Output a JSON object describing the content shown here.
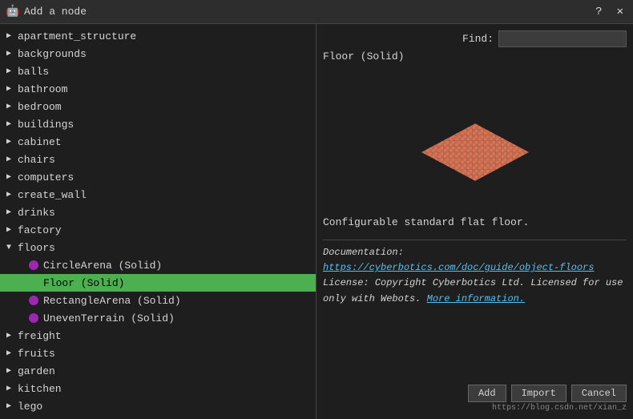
{
  "titleBar": {
    "icon": "🤖",
    "title": "Add a node",
    "helpBtn": "?",
    "closeBtn": "✕"
  },
  "findBar": {
    "label": "Find:",
    "placeholder": ""
  },
  "previewTitle": "Floor (Solid)",
  "previewDescription": "Configurable standard flat floor.",
  "documentation": {
    "label": "Documentation:",
    "linkText": "https://cyberbotics.com/doc/guide/object-floors",
    "licenseLabel": "License:",
    "licenseText": "Copyright Cyberbotics Ltd. Licensed for use only with Webots.",
    "moreInfoText": "More information."
  },
  "treeItems": [
    {
      "id": "apartment_structure",
      "label": "apartment_structure",
      "type": "parent",
      "expanded": false
    },
    {
      "id": "backgrounds",
      "label": "backgrounds",
      "type": "parent",
      "expanded": false
    },
    {
      "id": "balls",
      "label": "balls",
      "type": "parent",
      "expanded": false
    },
    {
      "id": "bathroom",
      "label": "bathroom",
      "type": "parent",
      "expanded": false
    },
    {
      "id": "bedroom",
      "label": "bedroom",
      "type": "parent",
      "expanded": false
    },
    {
      "id": "buildings",
      "label": "buildings",
      "type": "parent",
      "expanded": false
    },
    {
      "id": "cabinet",
      "label": "cabinet",
      "type": "parent",
      "expanded": false
    },
    {
      "id": "chairs",
      "label": "chairs",
      "type": "parent",
      "expanded": false
    },
    {
      "id": "computers",
      "label": "computers",
      "type": "parent",
      "expanded": false
    },
    {
      "id": "create_wall",
      "label": "create_wall",
      "type": "parent",
      "expanded": false
    },
    {
      "id": "drinks",
      "label": "drinks",
      "type": "parent",
      "expanded": false
    },
    {
      "id": "factory",
      "label": "factory",
      "type": "parent",
      "expanded": false
    },
    {
      "id": "floors",
      "label": "floors",
      "type": "parent",
      "expanded": true
    }
  ],
  "subItems": [
    {
      "id": "circle-arena",
      "label": "CircleArena (Solid)",
      "selected": false
    },
    {
      "id": "floor-solid",
      "label": "Floor (Solid)",
      "selected": true
    },
    {
      "id": "rectangle-arena",
      "label": "RectangleArena (Solid)",
      "selected": false
    },
    {
      "id": "uneven-terrain",
      "label": "UnevenTerrain (Solid)",
      "selected": false
    }
  ],
  "afterFloors": [
    {
      "id": "freight",
      "label": "freight"
    },
    {
      "id": "fruits",
      "label": "fruits"
    },
    {
      "id": "garden",
      "label": "garden"
    },
    {
      "id": "kitchen",
      "label": "kitchen"
    },
    {
      "id": "lego",
      "label": "lego"
    }
  ],
  "buttons": {
    "add": "Add",
    "import": "Import",
    "cancel": "Cancel"
  },
  "watermark": "https://blog.csdn.net/xian_z"
}
